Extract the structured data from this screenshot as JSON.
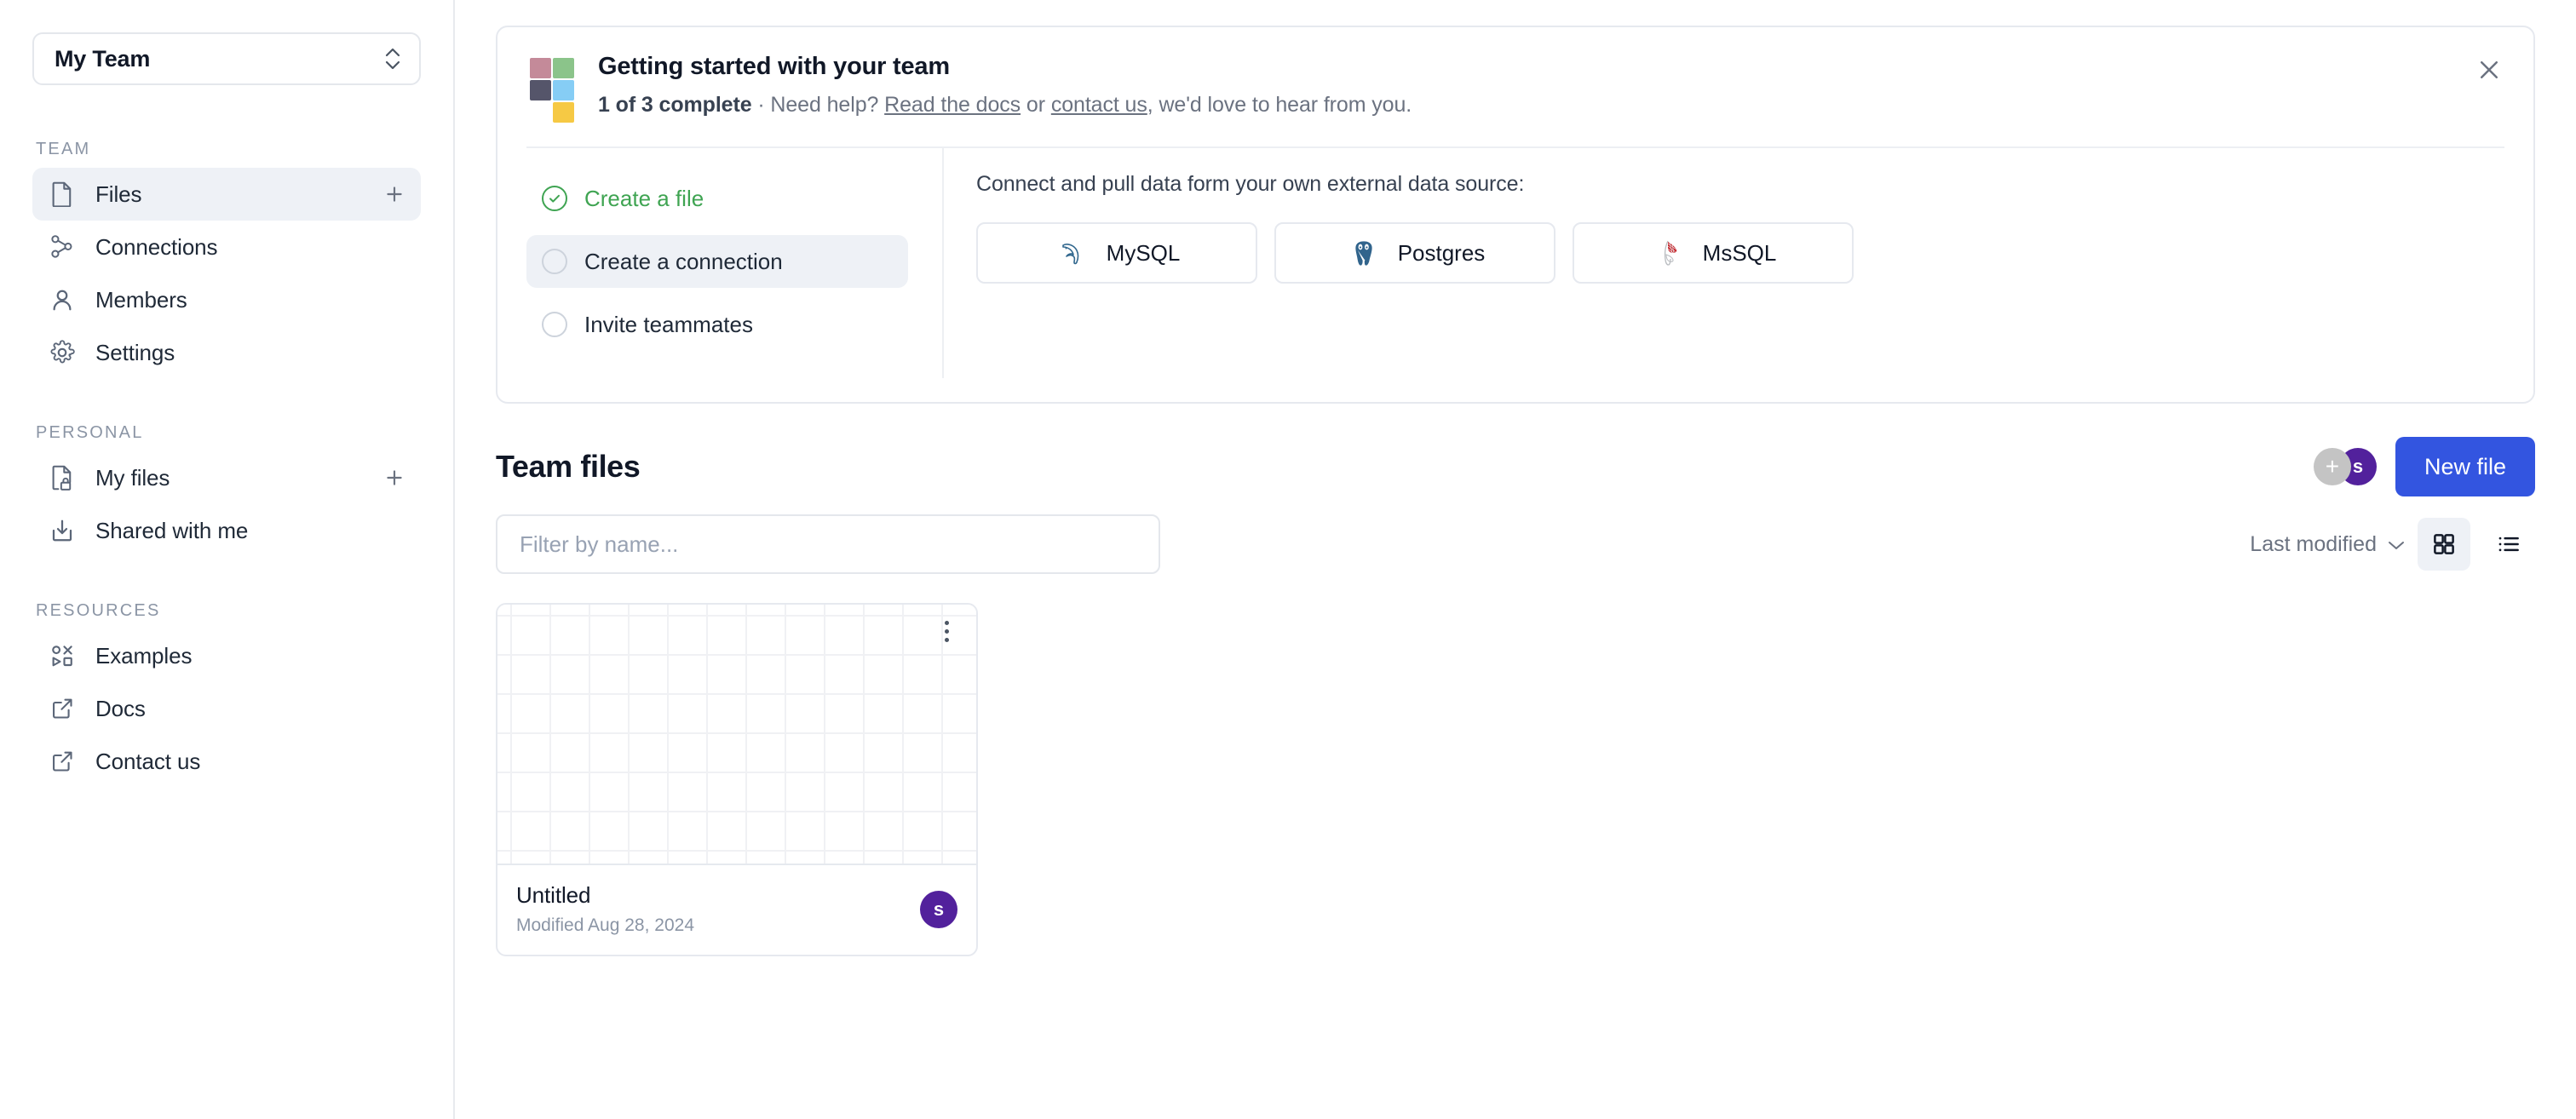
{
  "sidebar": {
    "team_switcher": {
      "label": "My Team",
      "icon": "chevron-up-down-icon"
    },
    "sections": [
      {
        "title": "TEAM",
        "items": [
          {
            "label": "Files",
            "icon": "file-icon",
            "active": true,
            "plus": true
          },
          {
            "label": "Connections",
            "icon": "connections-icon",
            "active": false,
            "plus": false
          },
          {
            "label": "Members",
            "icon": "user-icon",
            "active": false,
            "plus": false
          },
          {
            "label": "Settings",
            "icon": "gear-icon",
            "active": false,
            "plus": false
          }
        ]
      },
      {
        "title": "PERSONAL",
        "items": [
          {
            "label": "My files",
            "icon": "file-lock-icon",
            "active": false,
            "plus": true
          },
          {
            "label": "Shared with me",
            "icon": "inbox-download-icon",
            "active": false,
            "plus": false
          }
        ]
      },
      {
        "title": "RESOURCES",
        "items": [
          {
            "label": "Examples",
            "icon": "shapes-icon",
            "active": false,
            "plus": false
          },
          {
            "label": "Docs",
            "icon": "external-link-icon",
            "active": false,
            "plus": false
          },
          {
            "label": "Contact us",
            "icon": "external-link-icon",
            "active": false,
            "plus": false
          }
        ]
      }
    ]
  },
  "banner": {
    "title": "Getting started with your team",
    "progress": "1 of 3 complete",
    "separator": " · ",
    "need_help": "Need help? ",
    "link_docs": "Read the docs",
    "between_links": " or ",
    "link_contact": "contact us",
    "tail": ", we'd love to hear from you.",
    "close_icon": "close-icon",
    "logo_colors": [
      "#c48a99",
      "#8bc48a",
      "#55556a",
      "#86cdf5",
      "#f6c944"
    ],
    "checklist": [
      {
        "label": "Create a file",
        "done": true,
        "active": false
      },
      {
        "label": "Create a connection",
        "done": false,
        "active": true
      },
      {
        "label": "Invite teammates",
        "done": false,
        "active": false
      }
    ],
    "connect_label": "Connect and pull data form your own external data source:",
    "databases": [
      {
        "label": "MySQL",
        "icon": "mysql-dolphin-icon",
        "color": "#31678e"
      },
      {
        "label": "Postgres",
        "icon": "postgres-elephant-icon",
        "color": "#31648c"
      },
      {
        "label": "MsSQL",
        "icon": "mssql-icon",
        "color": "#c8272d"
      }
    ]
  },
  "files": {
    "title": "Team files",
    "add_member_label": "+",
    "member_initial": "s",
    "new_file_label": "New file",
    "filter_placeholder": "Filter by name...",
    "filter_value": "",
    "sort_label": "Last modified",
    "sort_icon": "chevron-down-icon",
    "view_grid_icon": "grid-view-icon",
    "view_list_icon": "list-view-icon",
    "active_view": "grid",
    "cards": [
      {
        "name": "Untitled",
        "modified": "Modified Aug 28, 2024",
        "owner_initial": "s",
        "menu_icon": "more-vertical-icon"
      }
    ]
  },
  "colors": {
    "accent": "#3355e0",
    "avatar_purple": "#52219c",
    "done_green": "#3fa452",
    "muted": "#8b95a5"
  }
}
